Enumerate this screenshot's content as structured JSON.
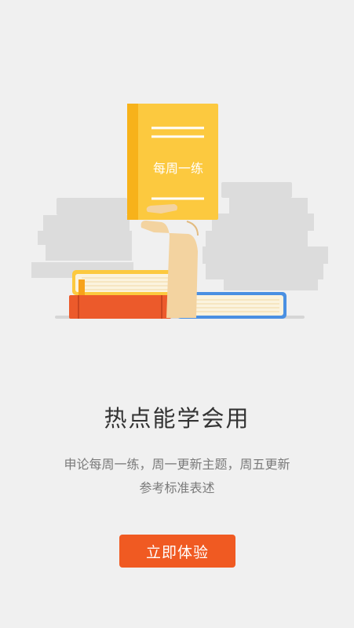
{
  "illustration": {
    "book_cover_text": "每周一练",
    "colors": {
      "book_yellow": "#fcc93f",
      "book_yellow_spine": "#f7b21a",
      "red_book": "#ec5a2b",
      "hand": "#f3d3a0",
      "shadow_books": "#dcdcdc",
      "blue_book": "#4a90e2"
    }
  },
  "headline": "热点能学会用",
  "description": {
    "line1": "申论每周一练，周一更新主题，周五更新",
    "line2": "参考标准表述"
  },
  "cta": {
    "label": "立即体验",
    "color": "#f05a22"
  }
}
